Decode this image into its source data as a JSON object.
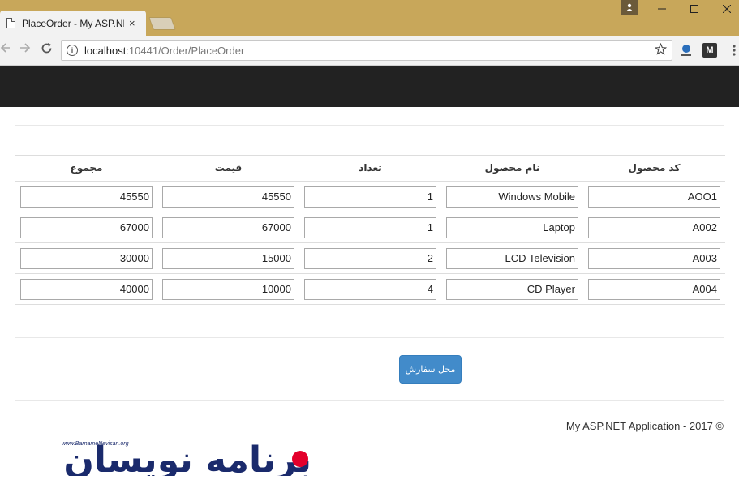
{
  "browser": {
    "tab_title": "PlaceOrder - My ASP.NET",
    "tab_close": "×",
    "url_host": "localhost",
    "url_rest": ":10441/Order/PlaceOrder",
    "ext_m": "M"
  },
  "table": {
    "headers": [
      "کد محصول",
      "نام محصول",
      "تعداد",
      "قیمت",
      "مجموع"
    ],
    "rows": [
      {
        "code": "AOO1",
        "name": "Windows Mobile",
        "qty": "1",
        "price": "45550",
        "total": "45550"
      },
      {
        "code": "A002",
        "name": "Laptop",
        "qty": "1",
        "price": "67000",
        "total": "67000"
      },
      {
        "code": "A003",
        "name": "LCD Television",
        "qty": "2",
        "price": "15000",
        "total": "30000"
      },
      {
        "code": "A004",
        "name": "CD Player",
        "qty": "4",
        "price": "10000",
        "total": "40000"
      }
    ]
  },
  "submit_label": "محل سفارش",
  "footer_text": "My ASP.NET Application - 2017 ©",
  "logo": {
    "text": "برنامه نویسان",
    "site": "www.BarnameNevisan.org"
  },
  "colors": {
    "titlebar": "#c8a75a",
    "navbar": "#222222",
    "button": "#428bca",
    "logo_blue": "#1a2a6c",
    "logo_red": "#e3002b"
  }
}
